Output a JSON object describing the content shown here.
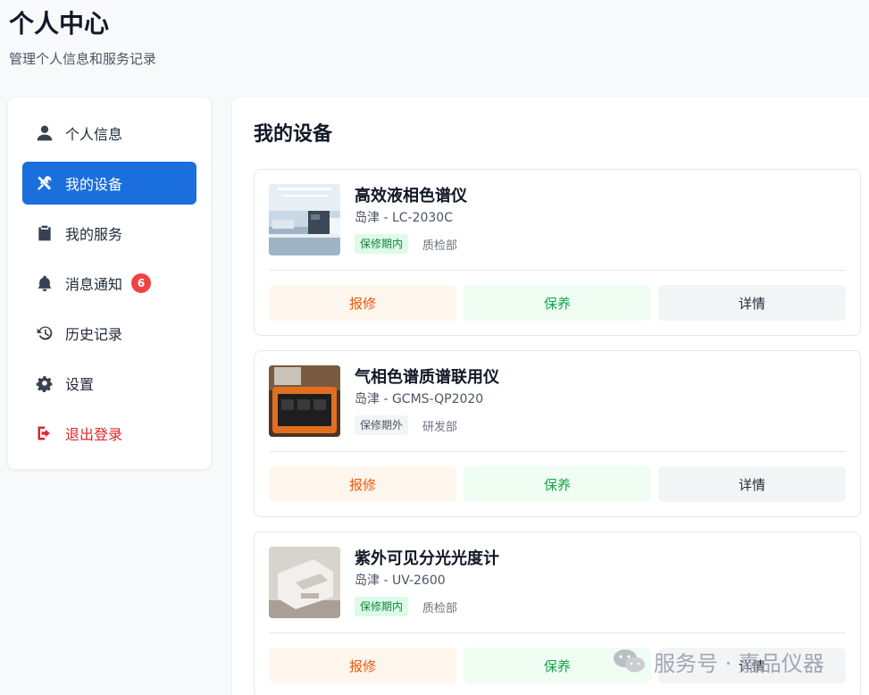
{
  "header": {
    "title": "个人中心",
    "subtitle": "管理个人信息和服务记录"
  },
  "sidebar": {
    "items": [
      {
        "label": "个人信息",
        "icon": "user-icon"
      },
      {
        "label": "我的设备",
        "icon": "tools-icon",
        "active": true
      },
      {
        "label": "我的服务",
        "icon": "clipboard-icon"
      },
      {
        "label": "消息通知",
        "icon": "bell-icon",
        "badge": "6"
      },
      {
        "label": "历史记录",
        "icon": "history-icon"
      },
      {
        "label": "设置",
        "icon": "gear-icon"
      },
      {
        "label": "退出登录",
        "icon": "logout-icon"
      }
    ]
  },
  "main": {
    "title": "我的设备",
    "devices": [
      {
        "name": "高效液相色谱仪",
        "model": "岛津 - LC-2030C",
        "warranty": "保修期内",
        "dept": "质检部"
      },
      {
        "name": "气相色谱质谱联用仪",
        "model": "岛津 - GCMS-QP2020",
        "warranty": "保修期外",
        "dept": "研发部"
      },
      {
        "name": "紫外可见分光光度计",
        "model": "岛津 - UV-2600",
        "warranty": "保修期内",
        "dept": "质检部"
      }
    ],
    "actions": {
      "repair": "报修",
      "maintain": "保养",
      "detail": "详情"
    }
  },
  "watermark": {
    "text": "服务号 · 嘉品仪器",
    "icon": "wechat-icon"
  },
  "colors": {
    "accent": "#1a6fdc",
    "danger": "#dc2626",
    "badge": "#ef4444",
    "repair": "#ea580c",
    "maintain": "#16a34a"
  }
}
